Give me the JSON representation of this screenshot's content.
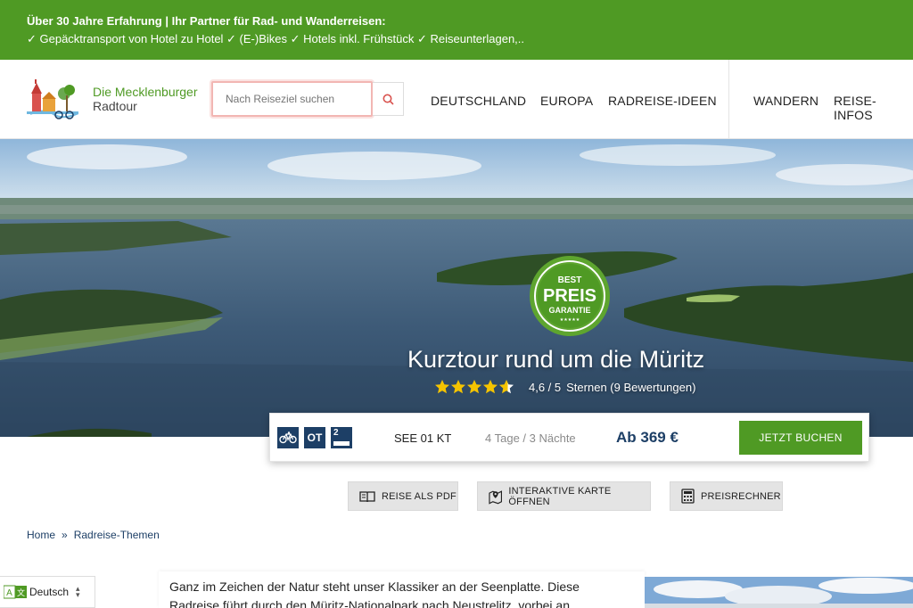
{
  "topbar": {
    "line1": "Über 30 Jahre Erfahrung | Ihr Partner für Rad- und Wanderreisen:",
    "line2": "✓ Gepäcktransport von Hotel zu Hotel ✓ (E-)Bikes ✓ Hotels inkl. Frühstück ✓ Reiseunterlagen,.."
  },
  "header": {
    "brand_line1": "Die Mecklenburger",
    "brand_line2": "Radtour",
    "search_placeholder": "Nach Reiseziel suchen",
    "nav": [
      "DEUTSCHLAND",
      "EUROPA",
      "RADREISE-IDEEN",
      "WANDERN",
      "REISE-INFOS"
    ]
  },
  "hero": {
    "badge_top": "BEST",
    "badge_mid": "PREIS",
    "badge_bot": "GARANTIE",
    "title": "Kurztour rund um die Müritz",
    "rating_value": "4,6 / 5",
    "rating_text": "Sternen (9 Bewertungen)",
    "stars": 4.6
  },
  "infobar": {
    "icon_ot": "OT",
    "icon_level": "2",
    "code": "SEE 01 KT",
    "duration": "4 Tage / 3 Nächte",
    "price": "Ab 369 €",
    "book_label": "JETZT BUCHEN"
  },
  "tools": [
    "REISE ALS PDF",
    "INTERAKTIVE KARTE ÖFFNEN",
    "PREISRECHNER"
  ],
  "breadcrumb": {
    "home": "Home",
    "sep": "»",
    "current": "Radreise-Themen"
  },
  "language": "Deutsch",
  "intro": {
    "line1": "Ganz im Zeichen der Natur steht unser Klassiker an der Seenplatte. Diese",
    "line2": "Radreise führt durch den Müritz-Nationalpark nach Neustrelitz, vorbei an"
  },
  "colors": {
    "brand_green": "#4f9a24",
    "navy": "#1d3f66",
    "star": "#f5c400"
  }
}
